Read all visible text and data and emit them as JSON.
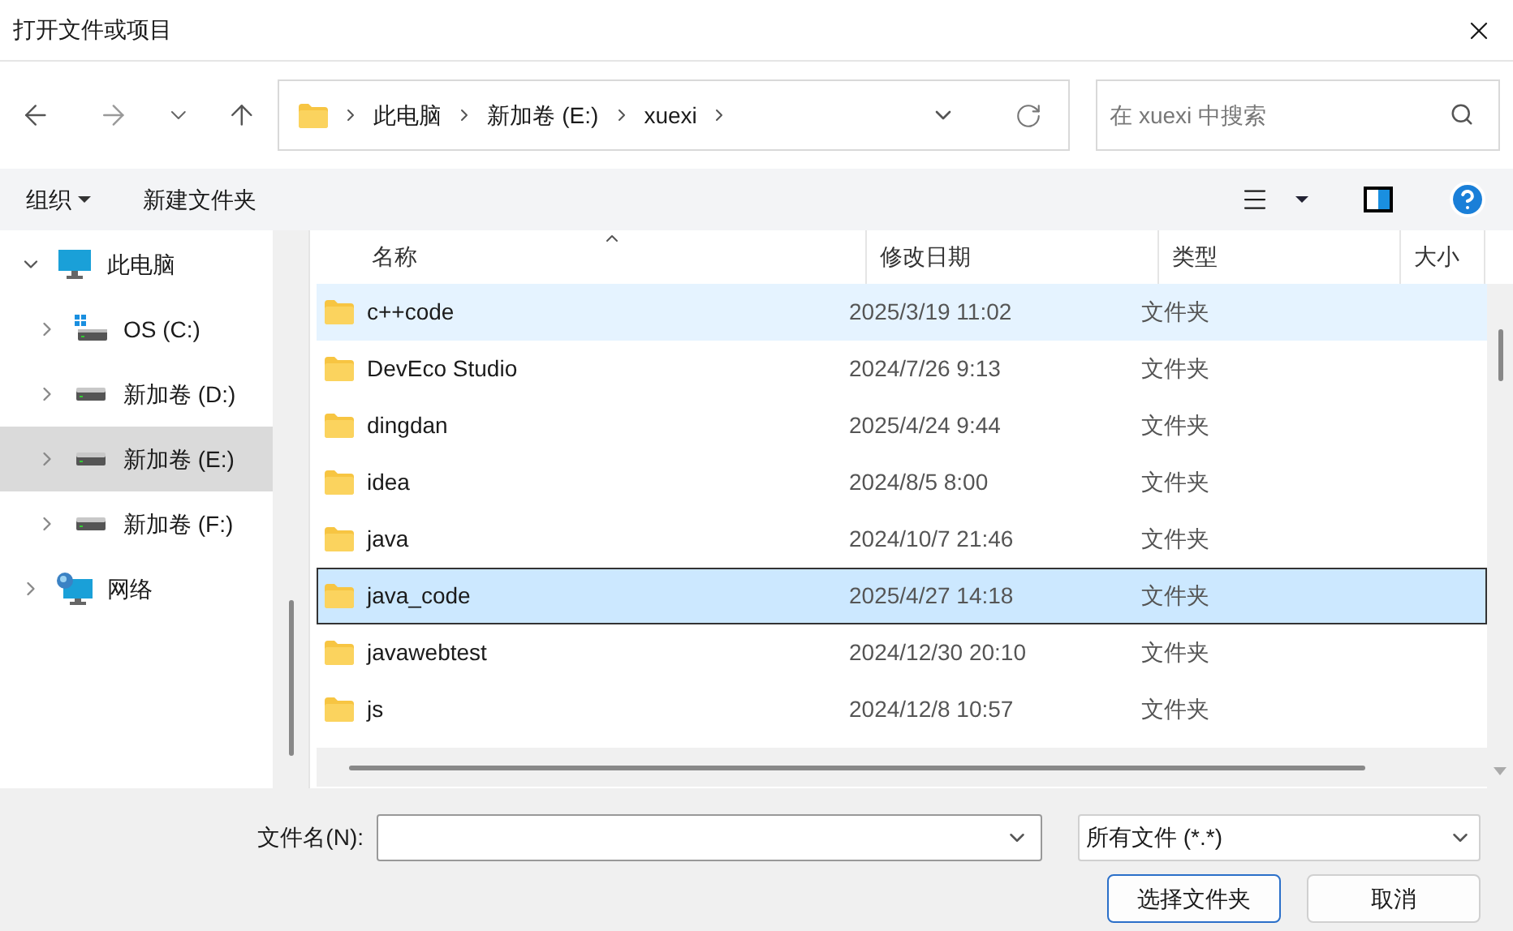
{
  "window": {
    "title": "打开文件或项目"
  },
  "address": {
    "crumbs": [
      "此电脑",
      "新加卷 (E:)",
      "xuexi"
    ]
  },
  "search": {
    "placeholder": "在 xuexi 中搜索"
  },
  "toolbar": {
    "organize": "组织",
    "new_folder": "新建文件夹"
  },
  "sidebar": {
    "items": [
      {
        "label": "此电脑",
        "kind": "pc",
        "expanded": true,
        "selected": false,
        "children": [
          {
            "label": "OS (C:)",
            "kind": "os-drive",
            "expanded": false,
            "selected": false
          },
          {
            "label": "新加卷 (D:)",
            "kind": "drive",
            "expanded": false,
            "selected": false
          },
          {
            "label": "新加卷 (E:)",
            "kind": "drive",
            "expanded": false,
            "selected": true
          },
          {
            "label": "新加卷 (F:)",
            "kind": "drive",
            "expanded": false,
            "selected": false
          }
        ]
      },
      {
        "label": "网络",
        "kind": "network",
        "expanded": false,
        "selected": false
      }
    ]
  },
  "table": {
    "columns": [
      "名称",
      "修改日期",
      "类型",
      "大小"
    ],
    "rows": [
      {
        "name": "c++code",
        "date": "2025/3/19 11:02",
        "type": "文件夹",
        "hovered": true,
        "selected": false
      },
      {
        "name": "DevEco Studio",
        "date": "2024/7/26 9:13",
        "type": "文件夹",
        "selected": false
      },
      {
        "name": "dingdan",
        "date": "2025/4/24 9:44",
        "type": "文件夹",
        "selected": false
      },
      {
        "name": "idea",
        "date": "2024/8/5 8:00",
        "type": "文件夹",
        "selected": false
      },
      {
        "name": "java",
        "date": "2024/10/7 21:46",
        "type": "文件夹",
        "selected": false
      },
      {
        "name": "java_code",
        "date": "2025/4/27 14:18",
        "type": "文件夹",
        "selected": true
      },
      {
        "name": "javawebtest",
        "date": "2024/12/30 20:10",
        "type": "文件夹",
        "selected": false
      },
      {
        "name": "js",
        "date": "2024/12/8 10:57",
        "type": "文件夹",
        "selected": false
      }
    ]
  },
  "footer": {
    "filename_label": "文件名(N):",
    "filter": "所有文件 (*.*)",
    "buttons": [
      {
        "label": "选择文件夹",
        "kind": "primary"
      },
      {
        "label": "取消",
        "kind": "secondary"
      }
    ]
  }
}
